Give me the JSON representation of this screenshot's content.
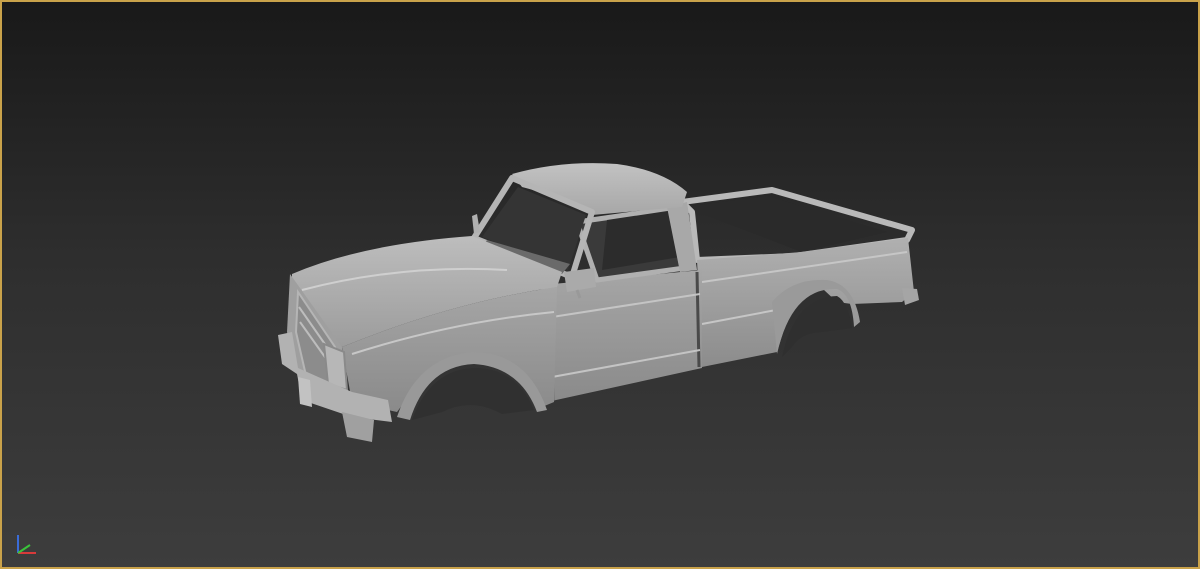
{
  "viewport": {
    "border_color": "#c9a24a",
    "background_top": "#191919",
    "background_bottom": "#3d3d3d",
    "model": {
      "shading": "gray-clay",
      "body_color": "#a9a9a9"
    },
    "gizmo": {
      "axes": [
        "x",
        "y",
        "z"
      ],
      "colors": {
        "x": "#d83a3a",
        "y": "#3ac43a",
        "z": "#3a6cd8"
      }
    }
  }
}
